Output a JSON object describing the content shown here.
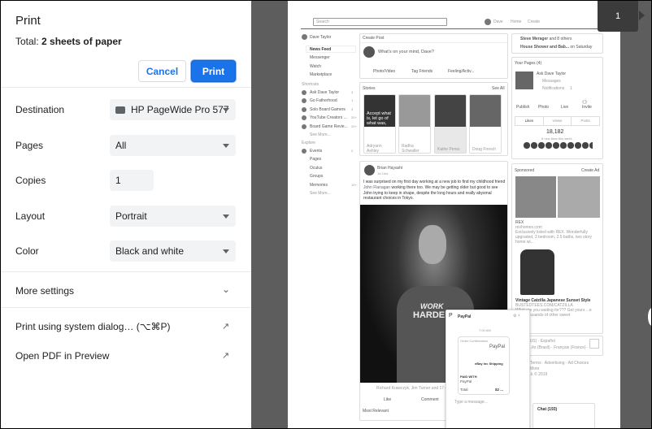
{
  "dialog": {
    "title": "Print",
    "total_prefix": "Total: ",
    "total_value": "2 sheets of paper",
    "cancel": "Cancel",
    "print": "Print",
    "destination_label": "Destination",
    "destination_value": "HP PageWide Pro 577",
    "pages_label": "Pages",
    "pages_value": "All",
    "copies_label": "Copies",
    "copies_value": "1",
    "layout_label": "Layout",
    "layout_value": "Portrait",
    "color_label": "Color",
    "color_value": "Black and white",
    "more_settings": "More settings",
    "system_dialog": "Print using system dialog… (⌥⌘P)",
    "open_pdf": "Open PDF in Preview",
    "accent": "#1a73e8"
  },
  "preview": {
    "page_number": "1",
    "header": {
      "search_placeholder": "Search",
      "user": "Dave",
      "home": "Home",
      "create": "Create"
    },
    "left_nav": {
      "user": "Dave Taylor",
      "items": [
        "News Feed",
        "Messenger",
        "Watch",
        "Marketplace"
      ],
      "shortcuts_heading": "Shortcuts",
      "shortcuts": [
        {
          "label": "Ask Dave Taylor",
          "count": "3"
        },
        {
          "label": "Go Fatherhood",
          "count": "1"
        },
        {
          "label": "Solo Board Gamers",
          "count": "3"
        },
        {
          "label": "YouTube Creators ...",
          "count": "20+"
        },
        {
          "label": "Board Game Revie...",
          "count": "20+"
        }
      ],
      "see_more_1": "See More...",
      "explore_heading": "Explore",
      "explore": [
        {
          "label": "Events",
          "count": "2"
        },
        {
          "label": "Pages",
          "count": ""
        },
        {
          "label": "Oculus",
          "count": ""
        },
        {
          "label": "Groups",
          "count": ""
        },
        {
          "label": "Memories",
          "count": "10+"
        }
      ],
      "see_more_2": "See More..."
    },
    "create_post": {
      "heading": "Create Post",
      "prompt": "What's on your mind, Dave?",
      "actions": [
        "Photo/Video",
        "Tag Friends",
        "Feeling/Activ..."
      ]
    },
    "stories": {
      "heading": "Stories",
      "see_all": "See All",
      "story_text": "Accept what is, let go of what was,",
      "names": [
        "Adryann Ashley",
        "Radha Schwaller",
        "Kathe Peres",
        "Doug French"
      ]
    },
    "post": {
      "author": "Brian Hayashi",
      "time": "1d 1hrs",
      "text_before": "I was surprised on my first day working at a new job to find my childhood friend ",
      "link": "John Flanagan",
      "text_after": " working there too. We may be getting older but good to see John trying to keep in shape, despite the long hours and really abysmal restaurant choices in Tokyo.",
      "shirt_line1": "WORK",
      "shirt_line2": "HARDER",
      "likes": "Richard Krawczyk, Jim Turner and 17 ot",
      "like": "Like",
      "comment": "Comment",
      "most_relevant": "Most Relevant"
    },
    "right": {
      "event1_bold": "Steve Merager",
      "event1_rest": " and 8 others",
      "event2_bold": "House Shower and Bab...",
      "event2_rest": " on Saturday",
      "pages_heading": "Your Pages (4)",
      "page_name": "Ask Dave Taylor",
      "messages": "Messages",
      "notifications": "Notifications",
      "notif_count": "1",
      "page_actions": [
        "Publish",
        "Photo",
        "Live",
        "Invite"
      ],
      "tabs": [
        "Likes",
        "Views",
        "Posts"
      ],
      "likes_count": "18,182",
      "likes_sub": "8 new likes this week",
      "sponsored": "Sponsored",
      "create_ad": "Create Ad",
      "ad1_title": "REX",
      "ad1_url": "rexhomes.com",
      "ad1_text": "Exclusively listed with REX. Wonderfully upgraded, 3 bedroom, 2.5 baths, two story home wi...",
      "ad2_title": "Vintage Catzilla Japanese Sunset Style",
      "ad2_url": "BUSTEDTEES.COM/CATZILLA",
      "ad2_text": "What are you waiting for??? Get yours ...e from thousands of other sweet",
      "lang1": "(US) · Español",
      "lang2": "...ês (Brasil) · Français (France) ·",
      "footer1": "· Terms · Advertising · Ad Choices",
      "footer2": "· More",
      "footer3": "...k © 2019",
      "chat": "Chat (193)"
    },
    "chat": {
      "name": "PayPal",
      "time": "7:00 AM",
      "order": "Order Confirmation",
      "brand": "PayPal",
      "shipping": "eBay Inc Shipping",
      "paid_with": "PAID WITH",
      "paid_value": "PayPal",
      "total": "Total",
      "total_value": "$2 ...",
      "placeholder": "Type a message..."
    }
  }
}
